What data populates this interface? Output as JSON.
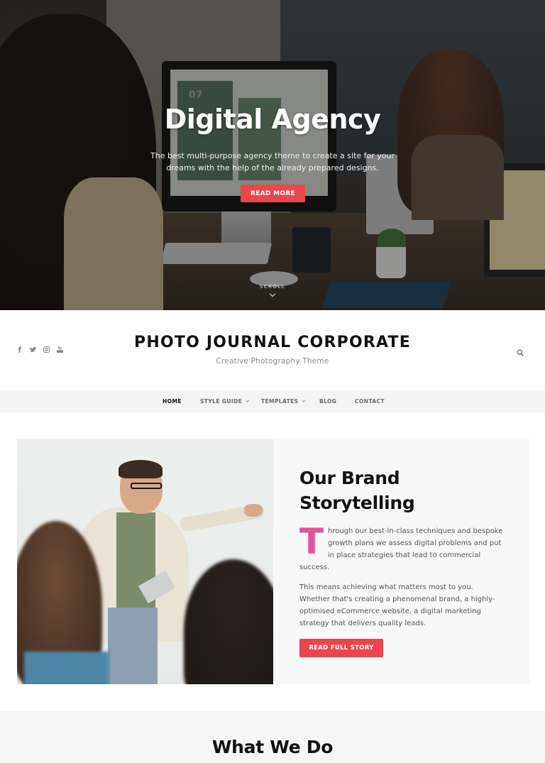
{
  "hero": {
    "title": "Digital Agency",
    "subtitle": "The best multi-purpose agency theme to create a site for your dreams with the help of the already prepared designs.",
    "button_label": "READ MORE",
    "scroll_label": "SCROLL",
    "screen_text": "07"
  },
  "header": {
    "site_title": "PHOTO JOURNAL CORPORATE",
    "tagline": "Creative Photography Theme",
    "social_icons": [
      "facebook-icon",
      "twitter-icon",
      "instagram-icon",
      "youtube-icon"
    ],
    "search_icon": "search-icon"
  },
  "nav": {
    "items": [
      {
        "label": "HOME",
        "active": true,
        "has_dropdown": false
      },
      {
        "label": "STYLE GUIDE",
        "active": false,
        "has_dropdown": true
      },
      {
        "label": "TEMPLATES",
        "active": false,
        "has_dropdown": true
      },
      {
        "label": "BLOG",
        "active": false,
        "has_dropdown": false
      },
      {
        "label": "CONTACT",
        "active": false,
        "has_dropdown": false
      }
    ]
  },
  "brand": {
    "heading_line1": "Our Brand",
    "heading_line2": "Storytelling",
    "dropcap": "T",
    "para1_line1": "hrough our best-in-class techniques and bespoke",
    "para1_line2": "growth plans we assess digital problems and put",
    "para1_line3": "in place strategies that lead to commercial",
    "para1_line4": "success.",
    "para2": "This means achieving what matters most to you. Whether that's creating a phenomenal brand, a highly-optimised eCommerce website, a digital marketing strategy that delivers quality leads.",
    "button_label": "READ FULL STORY"
  },
  "what_we_do": {
    "title": "What We Do"
  },
  "colors": {
    "accent": "#e9474b",
    "dropcap": "#e5539a",
    "nav_bg": "#f5f5f5",
    "panel_bg": "#f8f8f8"
  }
}
